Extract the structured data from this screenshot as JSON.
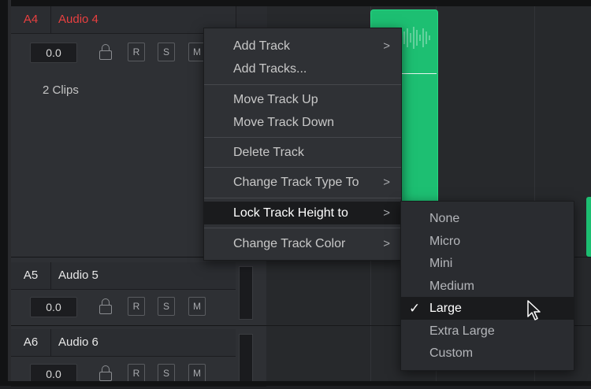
{
  "tracks": [
    {
      "id": "A4",
      "name": "Audio 4",
      "volume": "0.0",
      "buttons": [
        "R",
        "S",
        "M"
      ],
      "clip_count": "2 Clips",
      "color": "#e84040"
    },
    {
      "id": "A5",
      "name": "Audio 5",
      "volume": "0.0",
      "buttons": [
        "R",
        "S",
        "M"
      ]
    },
    {
      "id": "A6",
      "name": "Audio 6",
      "volume": "0.0",
      "buttons": [
        "R",
        "S",
        "M"
      ]
    }
  ],
  "context_menu": {
    "items": [
      {
        "label": "Add Track",
        "arrow": ">"
      },
      {
        "label": "Add Tracks..."
      },
      {
        "label": "Move Track Up"
      },
      {
        "label": "Move Track Down"
      },
      {
        "label": "Delete Track"
      },
      {
        "label": "Change Track Type To",
        "arrow": ">"
      },
      {
        "label": "Lock Track Height to",
        "arrow": ">"
      },
      {
        "label": "Change Track Color",
        "arrow": ">"
      }
    ]
  },
  "submenu": {
    "items": [
      "None",
      "Micro",
      "Mini",
      "Medium",
      "Large",
      "Extra Large",
      "Custom"
    ],
    "selected": "Large",
    "check": "✓"
  },
  "colors": {
    "clip": "#1dbf72",
    "track_active": "#e84040",
    "menu_bg": "#2f3135"
  },
  "icons": [
    "lock-icon",
    "submenu-arrow-icon",
    "checkmark-icon",
    "mouse-cursor-icon"
  ]
}
